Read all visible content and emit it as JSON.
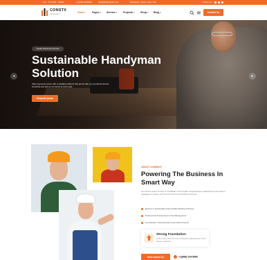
{
  "colors": {
    "accent": "#f26b24",
    "dark": "#1c1c1c"
  },
  "topbar": {
    "address": "Sun - Fri (9:00 - 18:00)",
    "phone": "+1(234) 5678900",
    "email": "info@buildingsite.com",
    "location": "Downtown, Street, New York",
    "follow": "Follow Us :"
  },
  "header": {
    "logo_name": "CONSTX",
    "logo_tagline": "Construction",
    "nav": [
      {
        "label": "Home",
        "caret": "▾"
      },
      {
        "label": "Pages",
        "caret": "▾"
      },
      {
        "label": "Service",
        "caret": "▾"
      },
      {
        "label": "Projects",
        "caret": "▾"
      },
      {
        "label": "Shop",
        "caret": "▾"
      },
      {
        "label": "Blog",
        "caret": "▾"
      }
    ],
    "contact_label": "Contact Us"
  },
  "hero": {
    "badge": "Quality Handyman Service",
    "title": "Sustainable Handyman Solution",
    "description": "Take payments online with a scalable platform that grows with your perfect business imperdiet sed quis ex ac luctus et enim eget.",
    "button_label": "Request Quote",
    "prev_icon": "◂",
    "next_icon": "▸"
  },
  "about": {
    "eyebrow": "ABOUT COMPANY",
    "title": "Powering The Business In Smart Way",
    "description": "Our service teams fit drop on installation. We provide comprehensive maintenance and support packages to ensure your comfort and home hazards at its best.",
    "features": [
      "Experts in Sustainable & Renewable Building Practices",
      "Professional Construction & Site Management",
      "Coordination of Residential Construction Projects"
    ],
    "card_title": "Strong Foundation",
    "card_desc": "Lorem ipsum dolor sit amet consectetur adipiscing elit. Proin lacinia, mi laoreet.",
    "more_label": "More About Us",
    "phone": "+1(888) 234-5660"
  }
}
